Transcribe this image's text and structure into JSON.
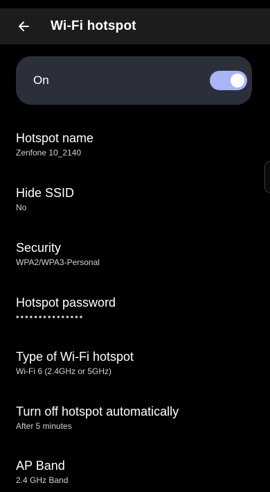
{
  "header": {
    "title": "Wi-Fi hotspot",
    "back_icon": "arrow-left-icon"
  },
  "master_switch": {
    "label": "On",
    "enabled": true,
    "accent_color": "#aab4f6"
  },
  "settings": [
    {
      "key": "hotspot-name",
      "title": "Hotspot name",
      "value": "Zenfone 10_2140"
    },
    {
      "key": "hide-ssid",
      "title": "Hide SSID",
      "value": "No"
    },
    {
      "key": "security",
      "title": "Security",
      "value": "WPA2/WPA3-Personal"
    },
    {
      "key": "hotspot-password",
      "title": "Hotspot password",
      "value": "•••••••••••••••"
    },
    {
      "key": "hotspot-type",
      "title": "Type of Wi-Fi hotspot",
      "value": "Wi-Fi 6 (2.4GHz or 5GHz)"
    },
    {
      "key": "auto-off",
      "title": "Turn off hotspot automatically",
      "value": "After 5 minutes"
    },
    {
      "key": "ap-band",
      "title": "AP Band",
      "value": "2.4 GHz Band"
    }
  ]
}
